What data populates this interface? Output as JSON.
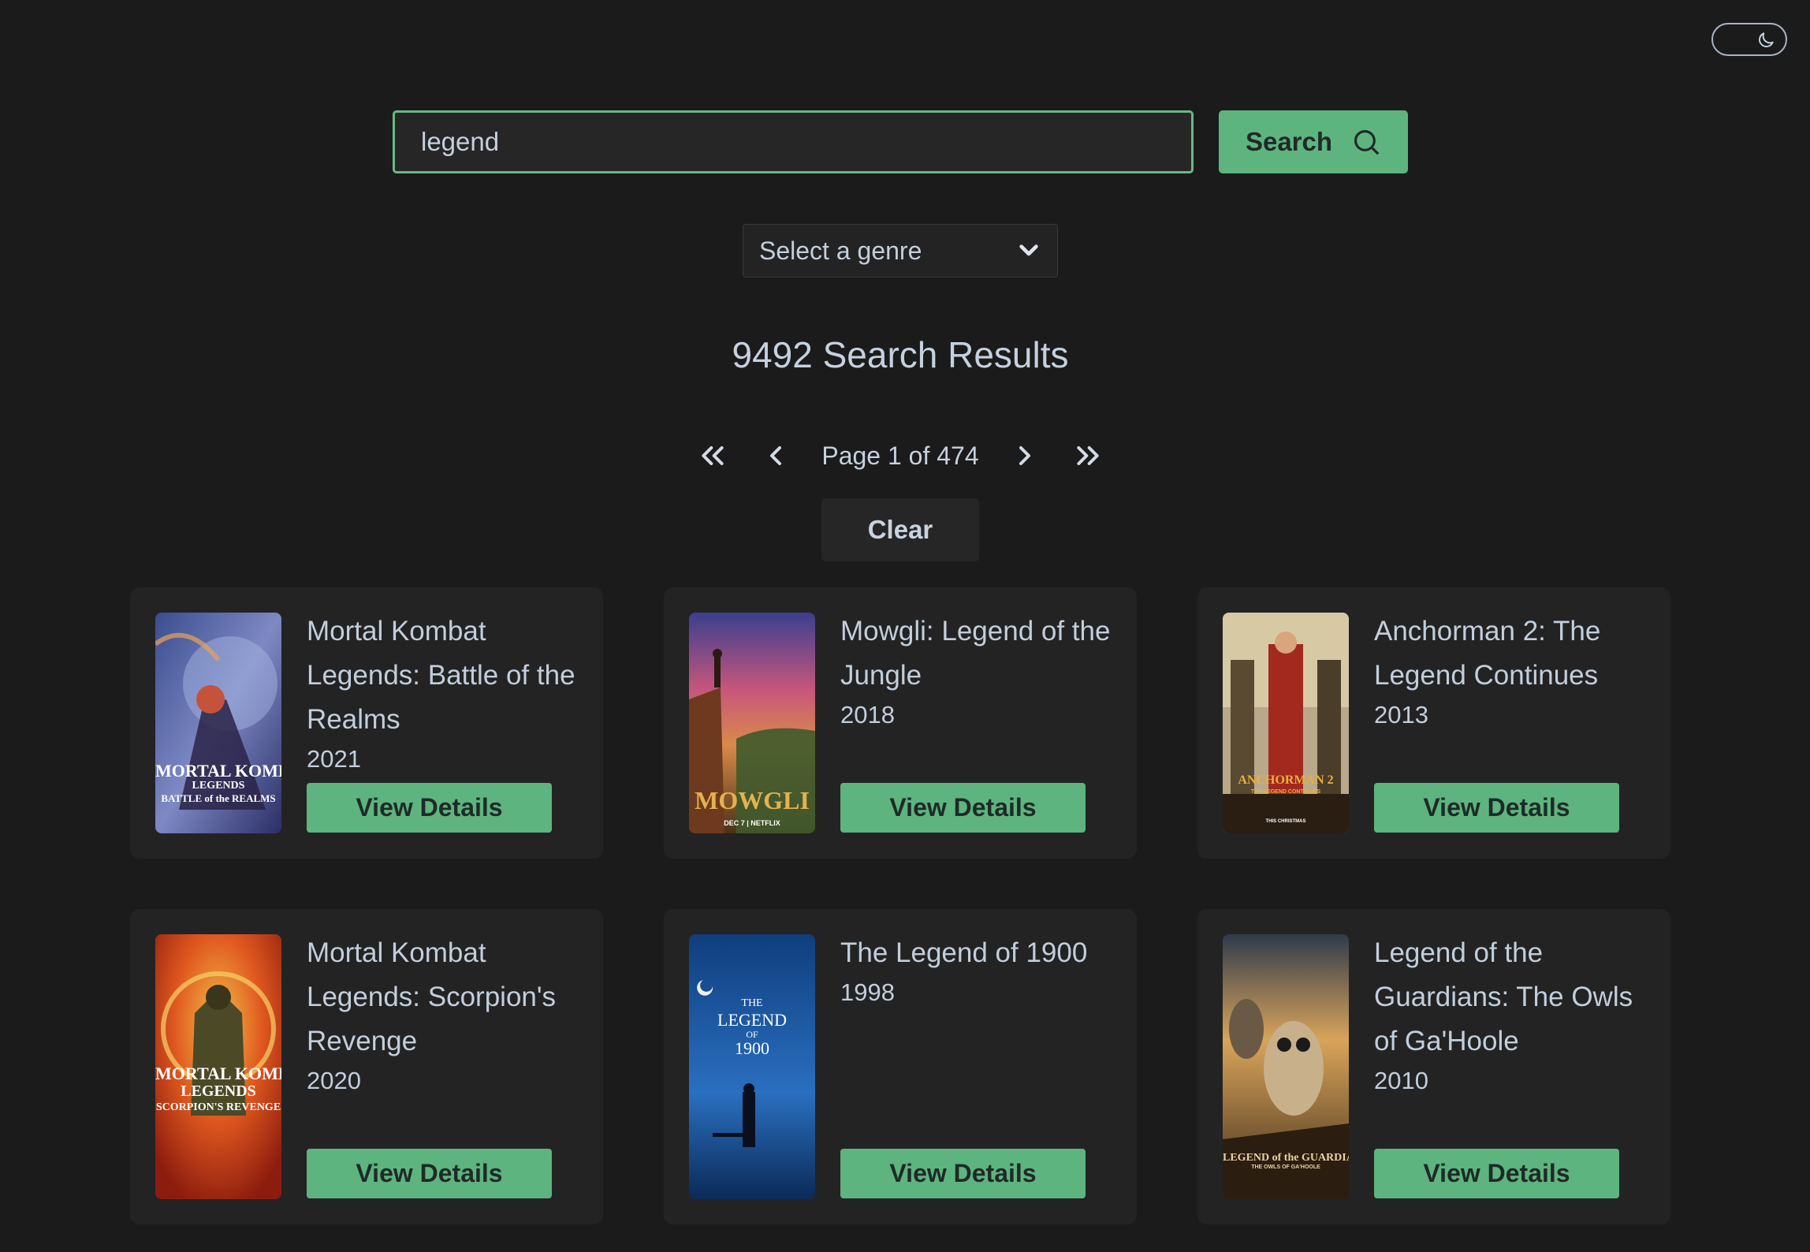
{
  "search": {
    "value": "legend",
    "button_label": "Search"
  },
  "genre": {
    "selected": "Select a genre"
  },
  "results": {
    "count_text": "9492 Search Results"
  },
  "pagination": {
    "page_text": "Page 1 of 474"
  },
  "clear_label": "Clear",
  "colors": {
    "background": "#1b1b1c",
    "card": "#232324",
    "accent": "#5db47f",
    "text": "#c2cedb"
  },
  "icons": {
    "theme": "moon-icon",
    "search": "search-icon",
    "dropdown": "chevron-down-icon",
    "first": "double-chevron-left-icon",
    "prev": "chevron-left-icon",
    "next": "chevron-right-icon",
    "last": "double-chevron-right-icon"
  },
  "movies": [
    {
      "title": "Mortal Kombat Legends: Battle of the Realms",
      "year": "2021",
      "button_label": "View Details",
      "poster_text": [
        "MORTAL KOMBAT",
        "LEGENDS",
        "BATTLE of the REALMS"
      ]
    },
    {
      "title": "Mowgli: Legend of the Jungle",
      "year": "2018",
      "button_label": "View Details",
      "poster_text": [
        "MOWGLI",
        "DEC 7 | NETFLIX"
      ]
    },
    {
      "title": "Anchorman 2: The Legend Continues",
      "year": "2013",
      "button_label": "View Details",
      "poster_text": [
        "ANCHORMAN 2",
        "THE LEGEND CONTINUES",
        "THIS CHRISTMAS"
      ]
    },
    {
      "title": "Mortal Kombat Legends: Scorpion's Revenge",
      "year": "2020",
      "button_label": "View Details",
      "poster_text": [
        "MORTAL KOMBAT",
        "LEGENDS",
        "SCORPION'S REVENGE"
      ]
    },
    {
      "title": "The Legend of 1900",
      "year": "1998",
      "button_label": "View Details",
      "poster_text": [
        "THE",
        "LEGEND",
        "OF",
        "1900"
      ]
    },
    {
      "title": "Legend of the Guardians: The Owls of Ga'Hoole",
      "year": "2010",
      "button_label": "View Details",
      "poster_text": [
        "LEGEND of the GUARDIANS",
        "THE OWLS OF GA'HOOLE"
      ]
    }
  ]
}
